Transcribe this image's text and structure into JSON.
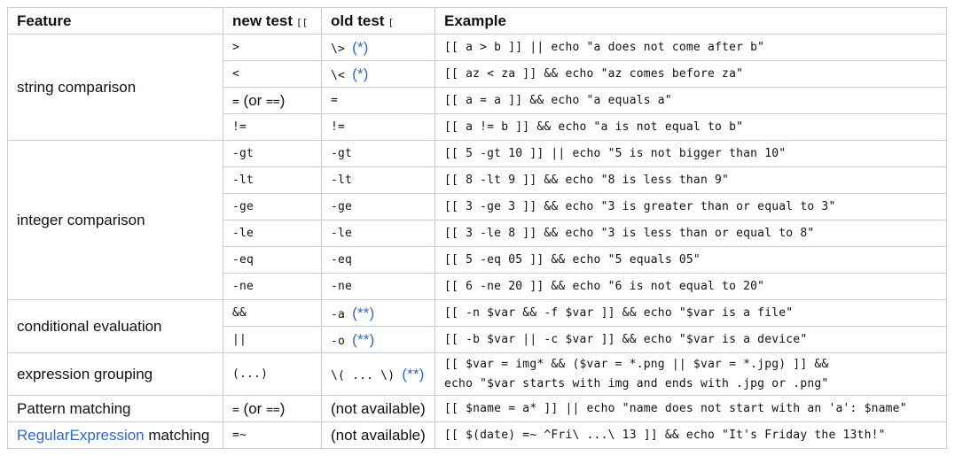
{
  "headers": {
    "feature": "Feature",
    "new_test": "new test",
    "new_test_code": "[[",
    "old_test": "old test",
    "old_test_code": "[",
    "example": "Example"
  },
  "groups": {
    "string": "string comparison",
    "integer": "integer comparison",
    "conditional": "conditional evaluation",
    "grouping": "expression grouping",
    "pattern": "Pattern matching",
    "regex_link": "RegularExpression",
    "regex_rest": " matching"
  },
  "rows": {
    "gt_new": ">",
    "gt_old": "\\>",
    "gt_ref": "(*)",
    "gt_ex": "[[ a > b ]] || echo \"a does not come after b\"",
    "lt_new": "<",
    "lt_old": "\\<",
    "lt_ref": "(*)",
    "lt_ex": "[[ az < za ]] && echo \"az comes before za\"",
    "eq_new_a": "=",
    "eq_new_b": " (or ",
    "eq_new_c": "==",
    "eq_new_d": ")",
    "eq_old": "=",
    "eq_ex": "[[ a = a ]] && echo \"a equals a\"",
    "ne_new": "!=",
    "ne_old": "!=",
    "ne_ex": "[[ a != b ]] && echo \"a is not equal to b\"",
    "igt": "-gt",
    "igt_ex": "[[ 5 -gt 10 ]] || echo \"5 is not bigger than 10\"",
    "ilt": "-lt",
    "ilt_ex": "[[ 8 -lt 9 ]] && echo \"8 is less than 9\"",
    "ige": "-ge",
    "ige_ex": "[[ 3 -ge 3 ]] && echo \"3 is greater than or equal to 3\"",
    "ile": "-le",
    "ile_ex": "[[ 3 -le 8 ]] && echo \"3 is less than or equal to 8\"",
    "ieq": "-eq",
    "ieq_ex": "[[ 5 -eq 05 ]] && echo \"5 equals 05\"",
    "ine": "-ne",
    "ine_ex": "[[ 6 -ne 20 ]] && echo \"6 is not equal to 20\"",
    "and_new": "&&",
    "and_old": "-a",
    "and_ref": "(**)",
    "and_ex": "[[ -n $var && -f $var ]] && echo \"$var is a file\"",
    "or_new": "||",
    "or_old": "-o",
    "or_ref": "(**)",
    "or_ex": "[[ -b $var || -c $var ]] && echo \"$var is a device\"",
    "grp_new": "(...)",
    "grp_old": "\\( ... \\)",
    "grp_ref": "(**)",
    "grp_ex1": "[[ $var = img* && ($var = *.png || $var = *.jpg) ]] &&",
    "grp_ex2": "echo \"$var starts with img and ends with .jpg or .png\"",
    "pm_new_a": "=",
    "pm_new_b": " (or ",
    "pm_new_c": "==",
    "pm_new_d": ")",
    "pm_old": "(not available)",
    "pm_ex": "[[ $name = a* ]] || echo \"name does not start with an 'a': $name\"",
    "re_new": "=~",
    "re_old": "(not available)",
    "re_ex": "[[ $(date) =~ ^Fri\\ ...\\ 13 ]] && echo \"It's Friday the 13th!\""
  },
  "colors": {
    "link": "#3366cc",
    "border": "#c8ccd1"
  }
}
